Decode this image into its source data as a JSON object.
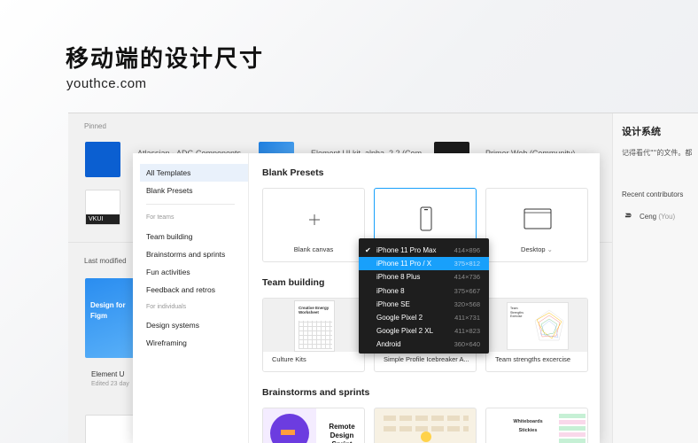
{
  "hero": {
    "title": "移动端的设计尺寸",
    "subtitle": "youthce.com"
  },
  "background": {
    "pinned_label": "Pinned",
    "pinned_items": [
      "Atlassian - ADG Components",
      "Element UI kit_alpha_2.2 (Com",
      "Primer Web (Community)"
    ],
    "vkui_label": "VKUI",
    "last_modified_label": "Last modified",
    "file_name": "Element U",
    "file_edited": "Edited 23 day",
    "file_thumb_text": "Design for Figm",
    "design_system_title": "设计系统",
    "design_system_note": "记得看代\"\"的文件。都",
    "recent_contributors_label": "Recent contributors",
    "contributor_name": "Ceng",
    "contributor_tag": "(You)"
  },
  "sidebar": {
    "all_templates": "All Templates",
    "blank_presets": "Blank Presets",
    "for_teams": "For teams",
    "team_items": [
      "Team building",
      "Brainstorms and sprints",
      "Fun activities",
      "Feedback and retros"
    ],
    "for_individuals": "For individuals",
    "individual_items": [
      "Design systems",
      "Wireframing"
    ]
  },
  "main": {
    "blank_presets_title": "Blank Presets",
    "blank_canvas_label": "Blank canvas",
    "desktop_label": "Desktop",
    "team_building_title": "Team building",
    "team_cards": [
      "Culture Kits",
      "Simple Profile Icebreaker A...",
      "Team strengths excercise"
    ],
    "team_card_text": [
      "Creative Energy Worksheet",
      "Team Strengths Exercise"
    ],
    "brainstorms_title": "Brainstorms and sprints",
    "brainstorm_cards": [
      "Remote Design Sprint",
      "Whiteboards Stickies"
    ]
  },
  "device_dropdown": {
    "items": [
      {
        "name": "iPhone 11 Pro Max",
        "size": "414×896",
        "checked": true
      },
      {
        "name": "iPhone 11 Pro / X",
        "size": "375×812",
        "highlighted": true
      },
      {
        "name": "iPhone 8 Plus",
        "size": "414×736"
      },
      {
        "name": "iPhone 8",
        "size": "375×667"
      },
      {
        "name": "iPhone SE",
        "size": "320×568"
      },
      {
        "name": "Google Pixel 2",
        "size": "411×731"
      },
      {
        "name": "Google Pixel 2 XL",
        "size": "411×823"
      },
      {
        "name": "Android",
        "size": "360×640"
      }
    ]
  },
  "colors": {
    "accent": "#18a0fb",
    "dropdown_bg": "#1e1e1e",
    "active_bg": "#e9f1fb"
  }
}
